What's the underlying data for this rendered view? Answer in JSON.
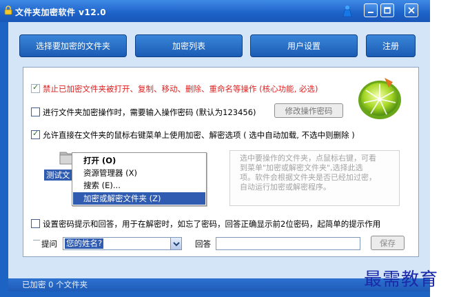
{
  "window": {
    "title": "文件夹加密软件 v12.0",
    "controls": {
      "minimize": "−",
      "maximize": "□",
      "close": "✕"
    }
  },
  "toolbar": {
    "select_folder": "选择要加密的文件夹",
    "encrypt_list": "加密列表",
    "user_settings": "用户设置",
    "register": "注册"
  },
  "options": {
    "forbid_ops": {
      "label": "禁止已加密文件夹被打开、复制、移动、删除、重命名等操作 (核心功能, 必选)",
      "checked": true,
      "color": "#e02020"
    },
    "require_pwd": {
      "label": "进行文件夹加密操作时，需要输入操作密码 (默认为123456)",
      "checked": false
    },
    "change_pwd_button": "修改操作密码",
    "context_menu_option": {
      "label": "允许直接在文件夹的鼠标右键菜单上使用加密、解密选项 ( 选中自动加载, 不选中则删除 )",
      "checked": true
    }
  },
  "demo": {
    "folder_label": "测试文",
    "menu": [
      {
        "label": "打开 (O)",
        "bold": true
      },
      {
        "label": "资源管理器 (X)",
        "bold": false
      },
      {
        "label": "搜索 (E)...",
        "bold": false
      },
      {
        "label": "加密或解密文件夹 (Z)",
        "bold": false,
        "selected": true
      }
    ],
    "hint_lines": [
      "选中要操作的文件夹，点鼠标右键，可看",
      "到菜单\"加密或解密文件夹\",选择此选",
      "项。软件会根据文件夹是否已经加过密，",
      "自动运行加密或解密程序。"
    ]
  },
  "password_hint": {
    "label": "设置密码提示和回答，用于在解密时，如忘了密码，回答正确显示前2位密码，起简单的提示作用",
    "checked": false,
    "question_label": "提问",
    "question_value": "您的姓名?",
    "answer_label": "回答",
    "answer_value": "",
    "save_button": "保存"
  },
  "status": {
    "text": "已加密 0 个文件夹"
  },
  "watermark": "最需教育"
}
